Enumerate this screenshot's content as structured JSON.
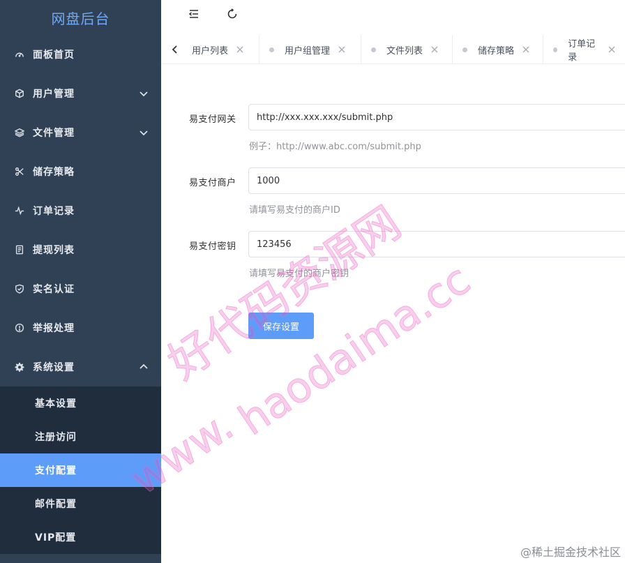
{
  "sidebar": {
    "brand": "网盘后台",
    "items": [
      {
        "label": "面板首页",
        "icon": "dashboard-icon"
      },
      {
        "label": "用户管理",
        "icon": "cube-icon",
        "expandable": true
      },
      {
        "label": "文件管理",
        "icon": "layers-icon",
        "expandable": true
      },
      {
        "label": "储存策略",
        "icon": "scissors-icon"
      },
      {
        "label": "订单记录",
        "icon": "pulse-icon"
      },
      {
        "label": "提现列表",
        "icon": "document-icon"
      },
      {
        "label": "实名认证",
        "icon": "shield-check-icon"
      },
      {
        "label": "举报处理",
        "icon": "info-circle-icon"
      },
      {
        "label": "系统设置",
        "icon": "gear-icon",
        "expanded": true
      }
    ],
    "subitems": [
      {
        "label": "基本设置"
      },
      {
        "label": "注册访问"
      },
      {
        "label": "支付配置",
        "active": true
      },
      {
        "label": "邮件配置"
      },
      {
        "label": "VIP配置"
      }
    ]
  },
  "tabs": [
    {
      "label": "用户列表"
    },
    {
      "label": "用户组管理"
    },
    {
      "label": "文件列表"
    },
    {
      "label": "储存策略"
    },
    {
      "label": "订单记录"
    }
  ],
  "form": {
    "gateway": {
      "label": "易支付网关",
      "value": "http://xxx.xxx.xxx/submit.php",
      "help": "例子：http://www.abc.com/submit.php"
    },
    "merchant": {
      "label": "易支付商户",
      "value": "1000",
      "help": "请填写易支付的商户ID"
    },
    "key": {
      "label": "易支付密钥",
      "value": "123456",
      "help": "请填写易支付的商户密钥"
    },
    "save_label": "保存设置"
  },
  "watermark": {
    "line1": "好代码资源网",
    "line2": "haodaima.cc",
    "line3": "www."
  },
  "corner_mark": "@稀土掘金技术社区",
  "colors": {
    "sidebar_bg": "#304156",
    "submenu_bg": "#1f2d3d",
    "accent": "#5d9cf8",
    "brand": "#6fa8f5"
  }
}
